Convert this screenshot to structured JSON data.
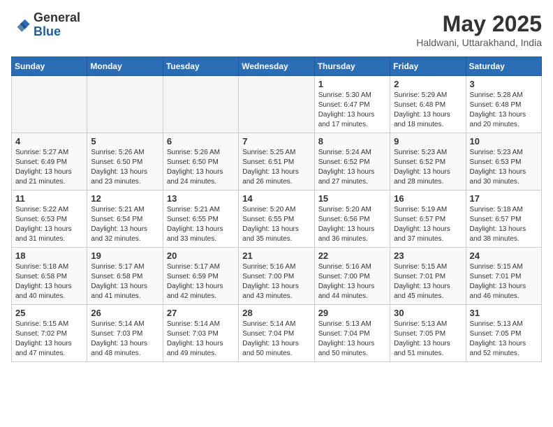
{
  "header": {
    "logo_general": "General",
    "logo_blue": "Blue",
    "month_title": "May 2025",
    "location": "Haldwani, Uttarakhand, India"
  },
  "weekdays": [
    "Sunday",
    "Monday",
    "Tuesday",
    "Wednesday",
    "Thursday",
    "Friday",
    "Saturday"
  ],
  "weeks": [
    [
      {
        "day": "",
        "info": ""
      },
      {
        "day": "",
        "info": ""
      },
      {
        "day": "",
        "info": ""
      },
      {
        "day": "",
        "info": ""
      },
      {
        "day": "1",
        "info": "Sunrise: 5:30 AM\nSunset: 6:47 PM\nDaylight: 13 hours\nand 17 minutes."
      },
      {
        "day": "2",
        "info": "Sunrise: 5:29 AM\nSunset: 6:48 PM\nDaylight: 13 hours\nand 18 minutes."
      },
      {
        "day": "3",
        "info": "Sunrise: 5:28 AM\nSunset: 6:48 PM\nDaylight: 13 hours\nand 20 minutes."
      }
    ],
    [
      {
        "day": "4",
        "info": "Sunrise: 5:27 AM\nSunset: 6:49 PM\nDaylight: 13 hours\nand 21 minutes."
      },
      {
        "day": "5",
        "info": "Sunrise: 5:26 AM\nSunset: 6:50 PM\nDaylight: 13 hours\nand 23 minutes."
      },
      {
        "day": "6",
        "info": "Sunrise: 5:26 AM\nSunset: 6:50 PM\nDaylight: 13 hours\nand 24 minutes."
      },
      {
        "day": "7",
        "info": "Sunrise: 5:25 AM\nSunset: 6:51 PM\nDaylight: 13 hours\nand 26 minutes."
      },
      {
        "day": "8",
        "info": "Sunrise: 5:24 AM\nSunset: 6:52 PM\nDaylight: 13 hours\nand 27 minutes."
      },
      {
        "day": "9",
        "info": "Sunrise: 5:23 AM\nSunset: 6:52 PM\nDaylight: 13 hours\nand 28 minutes."
      },
      {
        "day": "10",
        "info": "Sunrise: 5:23 AM\nSunset: 6:53 PM\nDaylight: 13 hours\nand 30 minutes."
      }
    ],
    [
      {
        "day": "11",
        "info": "Sunrise: 5:22 AM\nSunset: 6:53 PM\nDaylight: 13 hours\nand 31 minutes."
      },
      {
        "day": "12",
        "info": "Sunrise: 5:21 AM\nSunset: 6:54 PM\nDaylight: 13 hours\nand 32 minutes."
      },
      {
        "day": "13",
        "info": "Sunrise: 5:21 AM\nSunset: 6:55 PM\nDaylight: 13 hours\nand 33 minutes."
      },
      {
        "day": "14",
        "info": "Sunrise: 5:20 AM\nSunset: 6:55 PM\nDaylight: 13 hours\nand 35 minutes."
      },
      {
        "day": "15",
        "info": "Sunrise: 5:20 AM\nSunset: 6:56 PM\nDaylight: 13 hours\nand 36 minutes."
      },
      {
        "day": "16",
        "info": "Sunrise: 5:19 AM\nSunset: 6:57 PM\nDaylight: 13 hours\nand 37 minutes."
      },
      {
        "day": "17",
        "info": "Sunrise: 5:18 AM\nSunset: 6:57 PM\nDaylight: 13 hours\nand 38 minutes."
      }
    ],
    [
      {
        "day": "18",
        "info": "Sunrise: 5:18 AM\nSunset: 6:58 PM\nDaylight: 13 hours\nand 40 minutes."
      },
      {
        "day": "19",
        "info": "Sunrise: 5:17 AM\nSunset: 6:58 PM\nDaylight: 13 hours\nand 41 minutes."
      },
      {
        "day": "20",
        "info": "Sunrise: 5:17 AM\nSunset: 6:59 PM\nDaylight: 13 hours\nand 42 minutes."
      },
      {
        "day": "21",
        "info": "Sunrise: 5:16 AM\nSunset: 7:00 PM\nDaylight: 13 hours\nand 43 minutes."
      },
      {
        "day": "22",
        "info": "Sunrise: 5:16 AM\nSunset: 7:00 PM\nDaylight: 13 hours\nand 44 minutes."
      },
      {
        "day": "23",
        "info": "Sunrise: 5:15 AM\nSunset: 7:01 PM\nDaylight: 13 hours\nand 45 minutes."
      },
      {
        "day": "24",
        "info": "Sunrise: 5:15 AM\nSunset: 7:01 PM\nDaylight: 13 hours\nand 46 minutes."
      }
    ],
    [
      {
        "day": "25",
        "info": "Sunrise: 5:15 AM\nSunset: 7:02 PM\nDaylight: 13 hours\nand 47 minutes."
      },
      {
        "day": "26",
        "info": "Sunrise: 5:14 AM\nSunset: 7:03 PM\nDaylight: 13 hours\nand 48 minutes."
      },
      {
        "day": "27",
        "info": "Sunrise: 5:14 AM\nSunset: 7:03 PM\nDaylight: 13 hours\nand 49 minutes."
      },
      {
        "day": "28",
        "info": "Sunrise: 5:14 AM\nSunset: 7:04 PM\nDaylight: 13 hours\nand 50 minutes."
      },
      {
        "day": "29",
        "info": "Sunrise: 5:13 AM\nSunset: 7:04 PM\nDaylight: 13 hours\nand 50 minutes."
      },
      {
        "day": "30",
        "info": "Sunrise: 5:13 AM\nSunset: 7:05 PM\nDaylight: 13 hours\nand 51 minutes."
      },
      {
        "day": "31",
        "info": "Sunrise: 5:13 AM\nSunset: 7:05 PM\nDaylight: 13 hours\nand 52 minutes."
      }
    ]
  ]
}
